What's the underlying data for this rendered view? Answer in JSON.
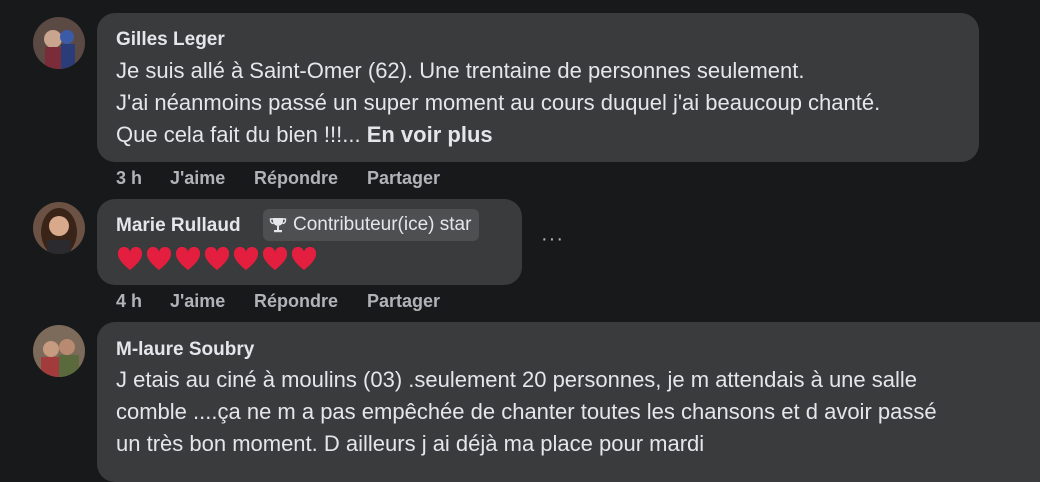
{
  "comments": [
    {
      "author": "Gilles Leger",
      "lines": [
        "Je suis allé à Saint-Omer (62). Une trentaine de personnes seulement.",
        "J'ai néanmoins passé un super moment au cours duquel j'ai beaucoup chanté.",
        "Que cela fait du bien !!!... "
      ],
      "see_more": "En voir plus",
      "time": "3 h",
      "like": "J'aime",
      "reply": "Répondre",
      "share": "Partager"
    },
    {
      "author": "Marie Rullaud",
      "badge": "Contributeur(ice) star",
      "hearts": 7,
      "time": "4 h",
      "like": "J'aime",
      "reply": "Répondre",
      "share": "Partager",
      "more": "···"
    },
    {
      "author": "M-laure Soubry",
      "lines": [
        "J etais au ciné à moulins (03) .seulement 20 personnes, je m attendais à une salle",
        "comble ....ça ne m a pas empêchée de chanter toutes les chansons et d avoir passé",
        "un très bon moment. D ailleurs j ai déjà ma place pour mardi"
      ]
    }
  ],
  "colors": {
    "background": "#18191a",
    "bubble": "#3a3b3c",
    "text": "#e4e6eb",
    "muted": "#b0b3b8",
    "heart": "#e41e3f"
  },
  "icons": {
    "badge": "trophy-icon",
    "heart": "red-heart-icon",
    "more": "more-options-icon"
  }
}
